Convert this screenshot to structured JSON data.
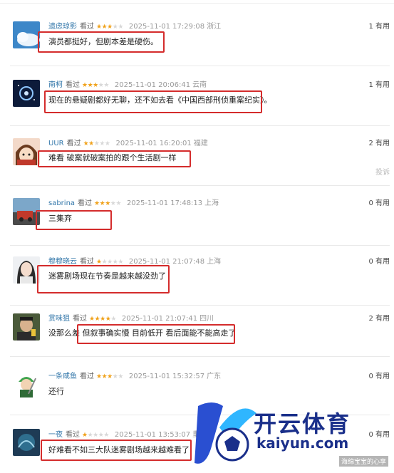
{
  "comments": [
    {
      "user": "遗虑琼影",
      "action": "看过",
      "stars_on": 3,
      "time": "2025-11-01 17:29:08",
      "location": "浙江",
      "useful": "1 有用",
      "text": "演员都挺好，但剧本差是硬伤。"
    },
    {
      "user": "南柯",
      "action": "看过",
      "stars_on": 3,
      "time": "2025-11-01 20:06:41",
      "location": "云南",
      "useful": "1 有用",
      "text": "现在的悬疑剧都好无聊，还不如去看《中国西部刑侦重案纪实》。"
    },
    {
      "user": "UUR",
      "action": "看过",
      "stars_on": 2,
      "time": "2025-11-01 16:20:01",
      "location": "福建",
      "useful": "2 有用",
      "text": "难看 破案就破案拍的跟个生活剧一样"
    },
    {
      "user": "sabrina",
      "action": "看过",
      "stars_on": 3,
      "time": "2025-11-01 17:48:13",
      "location": "上海",
      "useful": "0 有用",
      "text": "三集弃"
    },
    {
      "user": "穆穆晓云",
      "action": "看过",
      "stars_on": 1,
      "time": "2025-11-01 21:07:48",
      "location": "上海",
      "useful": "0 有用",
      "text": "迷雾剧场现在节奏是越来越没劲了"
    },
    {
      "user": "赏味狙",
      "action": "看过",
      "stars_on": 4,
      "time": "2025-11-01 21:07:41",
      "location": "四川",
      "useful": "2 有用",
      "text": "没那么差 但叙事确实慢 目前低开 看后面能不能高走了"
    },
    {
      "user": "一条咸鱼",
      "action": "看过",
      "stars_on": 3,
      "time": "2025-11-01 15:32:57",
      "location": "广东",
      "useful": "0 有用",
      "text": "还行"
    },
    {
      "user": "一夜",
      "action": "看过",
      "stars_on": 1,
      "time": "2025-11-01 13:53:07",
      "location": "重庆",
      "useful": "0 有用",
      "text": "好难看不如三大队迷雾剧场越来越难看了"
    }
  ],
  "report_label": "投诉",
  "star_glyph_on": "★",
  "star_glyph_off": "★",
  "watermark": {
    "brand_cn": "开云体育",
    "brand_en": "kaiyun.com",
    "credit": "海绵宝宝的心享"
  },
  "colors": {
    "username": "#3377aa",
    "star": "#f0a21b",
    "highlight": "#d42c2c",
    "brand": "#1a2f8a"
  }
}
